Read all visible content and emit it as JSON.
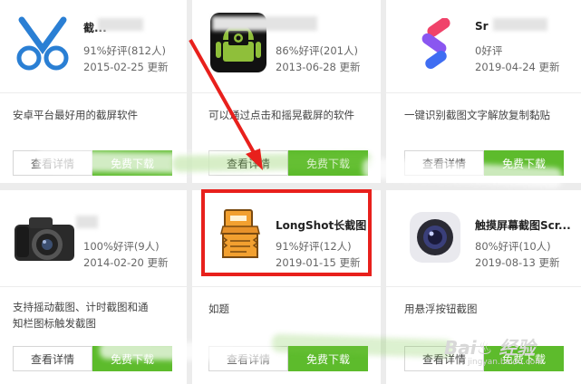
{
  "cards": [
    {
      "name": "截...",
      "rating": "91%好评(812人)",
      "date": "2015-02-25 更新",
      "desc": "安卓平台最好用的截屏软件",
      "detail": "查看详情",
      "download": "免费下载"
    },
    {
      "name": "",
      "rating": "86%好评(201人)",
      "date": "2013-06-28 更新",
      "desc": "可以通过点击和摇晃截屏的软件",
      "detail": "查看详情",
      "download": "免费下载"
    },
    {
      "name": "Sr",
      "rating": "0好评",
      "date": "2019-04-24 更新",
      "desc": "一键识别截图文字解放复制黏贴",
      "detail": "查看详情",
      "download": "免费下载"
    },
    {
      "name": "",
      "rating": "100%好评(9人)",
      "date": "2014-02-20 更新",
      "desc": "支持摇动截图、计时截图和通知栏图标触发截图",
      "detail": "查看详情",
      "download": "免费下载"
    },
    {
      "name": "LongShot长截图",
      "rating": "91%好评(12人)",
      "date": "2019-01-15 更新",
      "desc": "如题",
      "detail": "查看详情",
      "download": "免费下载"
    },
    {
      "name": "触摸屏幕截图Scr...",
      "rating": "80%好评(10人)",
      "date": "2019-08-13 更新",
      "desc": "用悬浮按钮截图",
      "detail": "查看详情",
      "download": "免费下载"
    }
  ],
  "watermark": {
    "text": "Bai♨ 经验",
    "url": "jingyan.baidu.com"
  },
  "colors": {
    "download_green": "#5dbb2c",
    "highlight_red": "#e8201c",
    "arrow_red": "#e8201c"
  },
  "icons": [
    "scissors-icon",
    "android-camera-icon",
    "sr-logo-icon",
    "dslr-camera-icon",
    "longshot-document-icon",
    "camera-lens-icon"
  ]
}
